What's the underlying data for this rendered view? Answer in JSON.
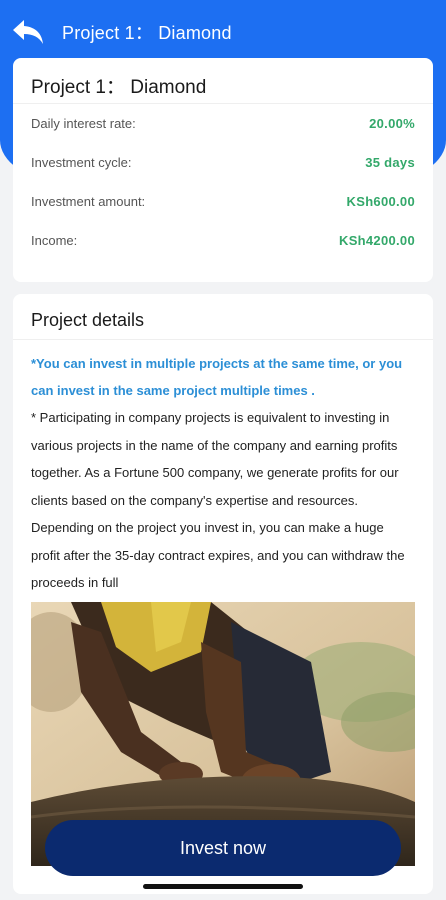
{
  "header": {
    "back_icon": "back-arrow-icon",
    "title": "Project 1： Diamond"
  },
  "summary": {
    "title": "Project 1： Diamond",
    "rows": [
      {
        "label": "Daily interest rate:",
        "value": "20.00%"
      },
      {
        "label": "Investment cycle:",
        "value": "35 days"
      },
      {
        "label": "Investment amount:",
        "value": "KSh600.00"
      },
      {
        "label": "Income:",
        "value": "KSh4200.00"
      }
    ],
    "value_color": "#33a86a"
  },
  "details": {
    "title": "Project details",
    "highlight": "*You can invest in multiple projects at the same time, or you can invest in the same project multiple times .",
    "body": "* Participating in company projects is equivalent to investing in various projects in the name of the company and earning profits together. As a Fortune 500 company, we generate profits for our clients based on the company's expertise and resources. Depending on the project you invest in, you can make a huge profit after the 35-day contract expires, and you can withdraw the proceeds in full",
    "highlight_color": "#2c8fd6"
  },
  "actions": {
    "invest_label": "Invest now",
    "button_color": "#0b2a6f"
  },
  "theme": {
    "header_color": "#1d6ff2"
  }
}
